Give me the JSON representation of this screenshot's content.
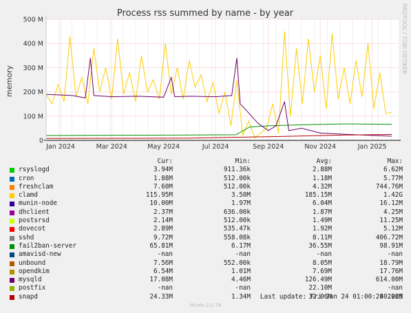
{
  "chart_data": {
    "type": "line",
    "title": "Process rss summed by name - by year",
    "ylabel": "memory",
    "side_text": "RRDTOOL / TOBI OETIKER",
    "ylim": [
      0,
      500000000
    ],
    "y_ticks": [
      {
        "value": 0,
        "label": "0"
      },
      {
        "value": 100000000,
        "label": "100 M"
      },
      {
        "value": 200000000,
        "label": "200 M"
      },
      {
        "value": 300000000,
        "label": "300 M"
      },
      {
        "value": 400000000,
        "label": "400 M"
      },
      {
        "value": 500000000,
        "label": "500 M"
      }
    ],
    "xlim": [
      "2023-12-15",
      "2025-02-01"
    ],
    "x_ticks": [
      {
        "value": "2024-01-01",
        "label": "Jan 2024"
      },
      {
        "value": "2024-03-01",
        "label": "Mar 2024"
      },
      {
        "value": "2024-05-01",
        "label": "May 2024"
      },
      {
        "value": "2024-07-01",
        "label": "Jul 2024"
      },
      {
        "value": "2024-09-01",
        "label": "Sep 2024"
      },
      {
        "value": "2024-11-01",
        "label": "Nov 2024"
      },
      {
        "value": "2025-01-01",
        "label": "Jan 2025"
      }
    ],
    "grid": true,
    "columns": [
      "",
      "Cur:",
      "Min:",
      "Avg:",
      "Max:"
    ],
    "series": [
      {
        "name": "rsyslogd",
        "color": "#00cc00",
        "cur": "3.94M",
        "min": "911.36k",
        "avg": "2.88M",
        "max": "6.62M"
      },
      {
        "name": "cron",
        "color": "#0066b3",
        "cur": "1.88M",
        "min": "512.00k",
        "avg": "1.18M",
        "max": "5.77M"
      },
      {
        "name": "freshclam",
        "color": "#ff8000",
        "cur": "7.60M",
        "min": "512.00k",
        "avg": "4.32M",
        "max": "744.76M"
      },
      {
        "name": "clamd",
        "color": "#ffcc00",
        "cur": "115.95M",
        "min": "3.50M",
        "avg": "185.15M",
        "max": "1.42G",
        "points": [
          [
            "2023-12-15",
            190000000
          ],
          [
            "2023-12-22",
            150000000
          ],
          [
            "2023-12-29",
            230000000
          ],
          [
            "2024-01-05",
            160000000
          ],
          [
            "2024-01-12",
            430000000
          ],
          [
            "2024-01-19",
            180000000
          ],
          [
            "2024-01-26",
            260000000
          ],
          [
            "2024-02-02",
            150000000
          ],
          [
            "2024-02-09",
            380000000
          ],
          [
            "2024-02-16",
            200000000
          ],
          [
            "2024-02-23",
            300000000
          ],
          [
            "2024-03-01",
            170000000
          ],
          [
            "2024-03-08",
            420000000
          ],
          [
            "2024-03-15",
            190000000
          ],
          [
            "2024-03-22",
            280000000
          ],
          [
            "2024-03-29",
            160000000
          ],
          [
            "2024-04-05",
            350000000
          ],
          [
            "2024-04-12",
            200000000
          ],
          [
            "2024-04-19",
            250000000
          ],
          [
            "2024-04-26",
            170000000
          ],
          [
            "2024-05-03",
            400000000
          ],
          [
            "2024-05-10",
            190000000
          ],
          [
            "2024-05-17",
            300000000
          ],
          [
            "2024-05-24",
            170000000
          ],
          [
            "2024-05-31",
            330000000
          ],
          [
            "2024-06-07",
            220000000
          ],
          [
            "2024-06-14",
            270000000
          ],
          [
            "2024-06-21",
            160000000
          ],
          [
            "2024-06-28",
            240000000
          ],
          [
            "2024-07-05",
            110000000
          ],
          [
            "2024-07-12",
            200000000
          ],
          [
            "2024-07-19",
            60000000
          ],
          [
            "2024-07-26",
            250000000
          ],
          [
            "2024-08-02",
            20000000
          ],
          [
            "2024-08-09",
            80000000
          ],
          [
            "2024-08-16",
            10000000
          ],
          [
            "2024-08-23",
            30000000
          ],
          [
            "2024-08-30",
            50000000
          ],
          [
            "2024-09-06",
            150000000
          ],
          [
            "2024-09-13",
            30000000
          ],
          [
            "2024-09-20",
            450000000
          ],
          [
            "2024-09-27",
            100000000
          ],
          [
            "2024-10-04",
            380000000
          ],
          [
            "2024-10-11",
            150000000
          ],
          [
            "2024-10-18",
            420000000
          ],
          [
            "2024-10-25",
            200000000
          ],
          [
            "2024-11-01",
            350000000
          ],
          [
            "2024-11-08",
            130000000
          ],
          [
            "2024-11-15",
            440000000
          ],
          [
            "2024-11-22",
            170000000
          ],
          [
            "2024-11-29",
            300000000
          ],
          [
            "2024-12-06",
            150000000
          ],
          [
            "2024-12-13",
            330000000
          ],
          [
            "2024-12-20",
            180000000
          ],
          [
            "2024-12-27",
            400000000
          ],
          [
            "2025-01-03",
            130000000
          ],
          [
            "2025-01-10",
            280000000
          ],
          [
            "2025-01-17",
            110000000
          ],
          [
            "2025-01-24",
            115950000
          ]
        ]
      },
      {
        "name": "munin-node",
        "color": "#330099",
        "cur": "10.00M",
        "min": "1.97M",
        "avg": "6.04M",
        "max": "16.12M"
      },
      {
        "name": "dhclient",
        "color": "#990099",
        "cur": "2.37M",
        "min": "636.00k",
        "avg": "1.87M",
        "max": "4.25M"
      },
      {
        "name": "postsrsd",
        "color": "#ccff00",
        "cur": "2.14M",
        "min": "512.00k",
        "avg": "1.49M",
        "max": "11.25M"
      },
      {
        "name": "dovecot",
        "color": "#ff0000",
        "cur": "2.89M",
        "min": "535.47k",
        "avg": "1.92M",
        "max": "5.12M"
      },
      {
        "name": "sshd",
        "color": "#808080",
        "cur": "9.72M",
        "min": "558.08k",
        "avg": "8.11M",
        "max": "406.72M"
      },
      {
        "name": "fail2ban-server",
        "color": "#008f00",
        "cur": "65.81M",
        "min": "6.17M",
        "avg": "36.55M",
        "max": "98.91M",
        "points": [
          [
            "2023-12-15",
            20000000
          ],
          [
            "2024-03-01",
            21000000
          ],
          [
            "2024-06-01",
            22000000
          ],
          [
            "2024-07-25",
            23000000
          ],
          [
            "2024-08-10",
            55000000
          ],
          [
            "2024-09-01",
            60000000
          ],
          [
            "2024-10-01",
            63000000
          ],
          [
            "2024-11-01",
            66000000
          ],
          [
            "2024-12-01",
            68000000
          ],
          [
            "2025-01-24",
            65810000
          ]
        ]
      },
      {
        "name": "amavisd-new",
        "color": "#00487d",
        "cur": "-nan",
        "min": "-nan",
        "avg": "-nan",
        "max": "-nan"
      },
      {
        "name": "unbound",
        "color": "#b35a00",
        "cur": "7.56M",
        "min": "552.00k",
        "avg": "8.05M",
        "max": "18.79M"
      },
      {
        "name": "opendkim",
        "color": "#b38f00",
        "cur": "6.54M",
        "min": "1.01M",
        "avg": "7.69M",
        "max": "17.76M"
      },
      {
        "name": "mysqld",
        "color": "#6b006b",
        "cur": "17.08M",
        "min": "4.46M",
        "avg": "126.49M",
        "max": "614.00M",
        "points": [
          [
            "2023-12-15",
            190000000
          ],
          [
            "2024-01-15",
            185000000
          ],
          [
            "2024-01-30",
            175000000
          ],
          [
            "2024-02-05",
            340000000
          ],
          [
            "2024-02-09",
            185000000
          ],
          [
            "2024-03-01",
            180000000
          ],
          [
            "2024-04-01",
            182000000
          ],
          [
            "2024-05-01",
            178000000
          ],
          [
            "2024-05-10",
            260000000
          ],
          [
            "2024-05-14",
            180000000
          ],
          [
            "2024-06-01",
            182000000
          ],
          [
            "2024-07-01",
            180000000
          ],
          [
            "2024-07-20",
            185000000
          ],
          [
            "2024-07-26",
            340000000
          ],
          [
            "2024-07-30",
            150000000
          ],
          [
            "2024-08-02",
            140000000
          ],
          [
            "2024-08-20",
            70000000
          ],
          [
            "2024-09-01",
            40000000
          ],
          [
            "2024-09-10",
            60000000
          ],
          [
            "2024-09-20",
            160000000
          ],
          [
            "2024-09-25",
            40000000
          ],
          [
            "2024-10-10",
            50000000
          ],
          [
            "2024-11-01",
            30000000
          ],
          [
            "2024-12-01",
            25000000
          ],
          [
            "2025-01-24",
            17080000
          ]
        ]
      },
      {
        "name": "postfix",
        "color": "#8fb300",
        "cur": "-nan",
        "min": "-nan",
        "avg": "22.10M",
        "max": "-nan"
      },
      {
        "name": "snapd",
        "color": "#b30000",
        "cur": "24.33M",
        "min": "1.34M",
        "avg": "32.06M",
        "max": "40.26M",
        "points": [
          [
            "2023-12-15",
            8000000
          ],
          [
            "2024-06-01",
            9000000
          ],
          [
            "2024-09-01",
            15000000
          ],
          [
            "2024-12-01",
            22000000
          ],
          [
            "2025-01-24",
            24330000
          ]
        ]
      }
    ]
  },
  "footer": {
    "last_update": "Last update: Fri Jan 24 01:00:28 2025",
    "version": "Munin 2.0.76"
  }
}
